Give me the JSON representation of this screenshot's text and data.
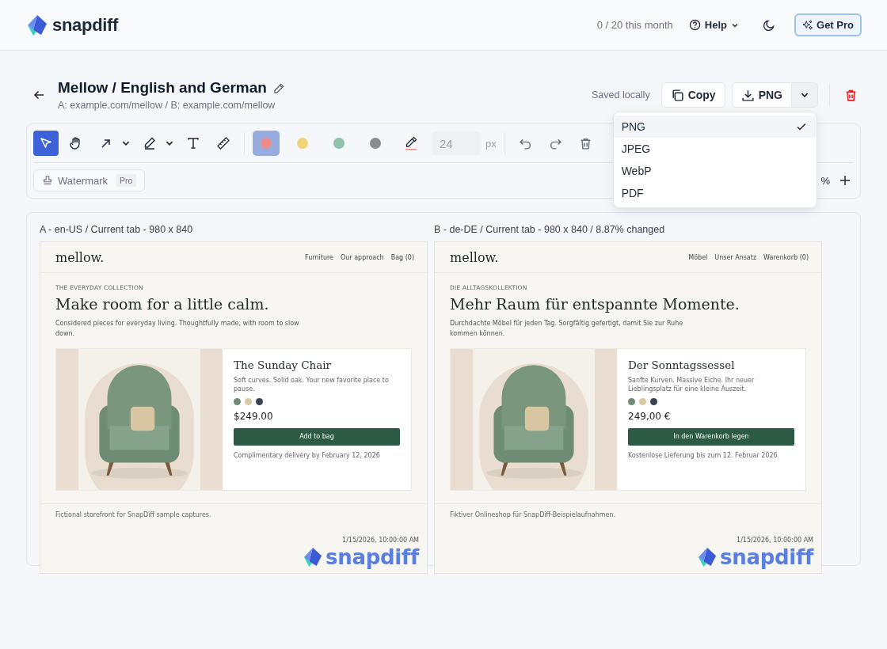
{
  "header": {
    "brand": "snapdiff",
    "usage": "0 / 20 this month",
    "help": "Help",
    "upgrade": "Get Pro"
  },
  "project": {
    "title": "Mellow / English and German",
    "subtitle": "A: example.com/mellow / B: example.com/mellow",
    "save_status": "Saved locally",
    "copy": "Copy",
    "export": "PNG",
    "export_menu": [
      {
        "label": "PNG",
        "selected": true
      },
      {
        "label": "JPEG",
        "selected": false
      },
      {
        "label": "WebP",
        "selected": false
      },
      {
        "label": "PDF",
        "selected": false
      }
    ]
  },
  "toolbar": {
    "tools": [
      {
        "kind": "select",
        "selected": true,
        "menu": false
      },
      {
        "kind": "hand",
        "selected": false,
        "menu": false
      },
      {
        "kind": "arrow",
        "selected": false,
        "menu": true
      },
      {
        "kind": "pen",
        "selected": false,
        "menu": true
      },
      {
        "kind": "text",
        "selected": false,
        "menu": false
      },
      {
        "kind": "ruler",
        "selected": false,
        "menu": false
      }
    ],
    "colors": [
      {
        "color": "#ef8c8c",
        "selected": true
      },
      {
        "color": "#f2d37c",
        "selected": false
      },
      {
        "color": "#8fc1ab",
        "selected": false
      },
      {
        "color": "#8b8b90",
        "selected": false
      }
    ],
    "size": {
      "placeholder": "24",
      "disabled": true
    },
    "unit": "px",
    "watermark": {
      "label": "Watermark",
      "badge": "Pro"
    },
    "zoom": "%"
  },
  "captures": [
    {
      "label": "A - en-US / Current tab - 980 x 840",
      "brand": "mellow.",
      "nav": [
        "Furniture",
        "Our approach",
        "Bag (0)"
      ],
      "eyebrow": "THE EVERYDAY COLLECTION",
      "headline": "Make room for a little calm.",
      "intro": "Considered pieces for everyday living. Thoughtfully made, with room to slow down.",
      "product": {
        "name": "The Sunday Chair",
        "description": "Soft curves. Solid oak. Your new favorite place to pause.",
        "swatches": [
          {
            "color": "#6f8a75"
          },
          {
            "color": "#d8c8a8"
          },
          {
            "color": "#39424f"
          }
        ],
        "price": "$249.00",
        "button": "Add to bag",
        "delivery": "Complimentary delivery by February 12, 2026"
      },
      "footer": "Fictional storefront for SnapDiff sample captures.",
      "timestamp": "1/15/2026, 10:00:00 AM",
      "watermark": "snapdiff"
    },
    {
      "label": "B - de-DE / Current tab - 980 x 840 / 8.87% changed",
      "brand": "mellow.",
      "nav": [
        "Möbel",
        "Unser Ansatz",
        "Warenkorb (0)"
      ],
      "eyebrow": "DIE ALLTAGSKOLLEKTION",
      "headline": "Mehr Raum für entspannte Momente.",
      "intro": "Durchdachte Möbel für jeden Tag. Sorgfältig gefertigt, damit Sie zur Ruhe kommen können.",
      "product": {
        "name": "Der Sonntagssessel",
        "description": "Sanfte Kurven. Massive Eiche. Ihr neuer Lieblingsplatz für eine kleine Auszeit.",
        "swatches": [
          {
            "color": "#6f8a75"
          },
          {
            "color": "#d8c8a8"
          },
          {
            "color": "#39424f"
          }
        ],
        "price": "249,00 €",
        "button": "In den Warenkorb legen",
        "delivery": "Kostenlose Lieferung bis zum 12. Februar 2026"
      },
      "footer": "Fiktiver Onlineshop für SnapDiff-Beispielaufnahmen.",
      "timestamp": "1/15/2026, 10:00:00 AM",
      "watermark": "snapdiff"
    }
  ]
}
